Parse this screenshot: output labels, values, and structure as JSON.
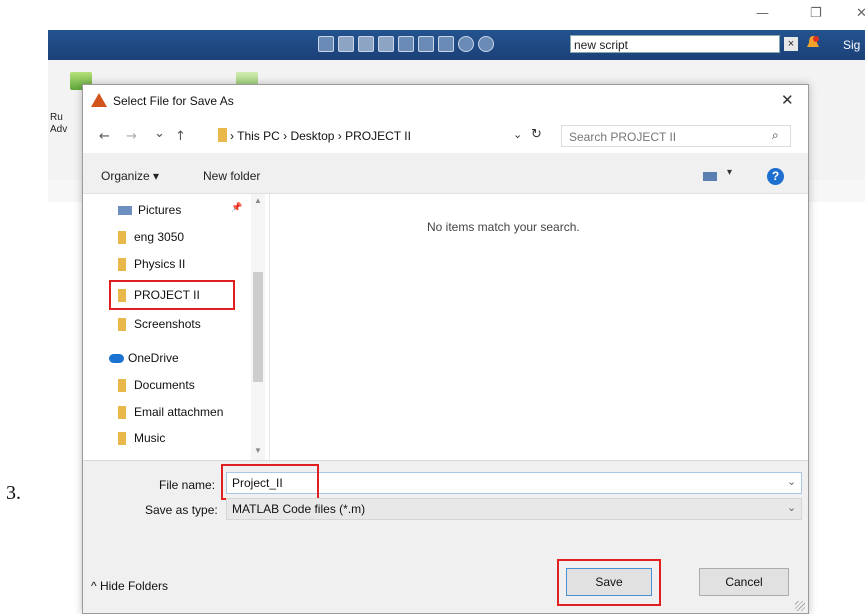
{
  "matlab": {
    "minimize": "—",
    "restore": "❐",
    "close": "✕",
    "search_value": "new script",
    "search_clear": "×",
    "sign_in": "Sig",
    "run_label_1": "Ru",
    "run_label_2": "Adv"
  },
  "step_number": "3.",
  "dialog": {
    "title": "Select File for Save As",
    "close": "✕",
    "nav": {
      "back": "←",
      "forward": "→",
      "recent": "⌄",
      "up": "↑"
    },
    "breadcrumb": "› This PC › Desktop › PROJECT II",
    "address_dropdown": "⌄",
    "refresh": "↻",
    "search_placeholder": "Search PROJECT II",
    "search_icon": "⌕",
    "organize": "Organize ▾",
    "new_folder": "New folder",
    "view_dropdown": "▾",
    "help": "?",
    "tree": {
      "items": [
        {
          "label": "Pictures",
          "kind": "pictures"
        },
        {
          "label": "eng 3050",
          "kind": "folder"
        },
        {
          "label": "Physics II",
          "kind": "folder"
        },
        {
          "label": "PROJECT II",
          "kind": "folder",
          "selected": true
        },
        {
          "label": "Screenshots",
          "kind": "folder"
        },
        {
          "label": "OneDrive",
          "kind": "cloud"
        },
        {
          "label": "Documents",
          "kind": "folder"
        },
        {
          "label": "Email attachmen",
          "kind": "folder"
        },
        {
          "label": "Music",
          "kind": "folder"
        }
      ],
      "pin": "📌",
      "scroll_up": "▲",
      "scroll_down": "▼"
    },
    "empty_message": "No items match your search.",
    "file_name_label": "File name:",
    "file_name_value": "Project_II",
    "save_type_label": "Save as type:",
    "save_type_value": "MATLAB Code files (*.m)",
    "combo_arrow": "⌄",
    "hide_folders": "^ Hide Folders",
    "save_button": "Save",
    "cancel_button": "Cancel"
  },
  "colors": {
    "highlight_box": "#e02020",
    "toolstrip": "#1b4078",
    "folder": "#e8b84a"
  }
}
